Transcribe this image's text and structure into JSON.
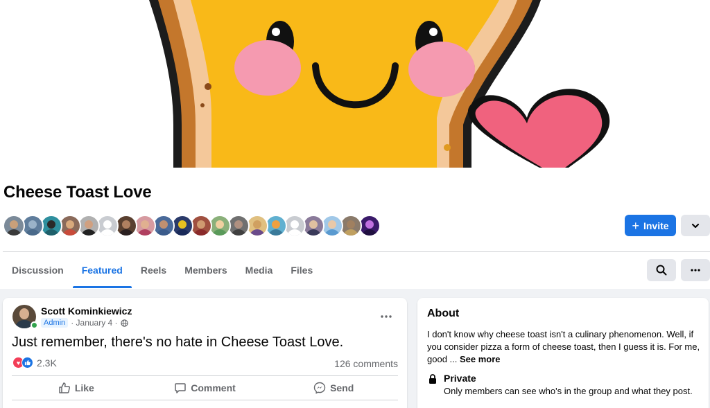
{
  "group": {
    "name": "Cheese Toast Love",
    "invite_label": "Invite"
  },
  "members_preview": [
    {
      "face": "#c9a07a",
      "body": "#3a3a3a",
      "bg": "#7b8a99"
    },
    {
      "face": "#9bb3c9",
      "body": "#4a6a8a",
      "bg": "#5f7d9c"
    },
    {
      "face": "#2a2a2a",
      "body": "#1e5f6a",
      "bg": "#2e8f9e"
    },
    {
      "face": "#d8a97c",
      "body": "#c84b3a",
      "bg": "#8a6a5a"
    },
    {
      "face": "#d0a080",
      "body": "#222222",
      "bg": "#b0b0b0"
    },
    {
      "face": "#ffffff",
      "body": "#ffffff",
      "bg": "#c9ccd1"
    },
    {
      "face": "#b08060",
      "body": "#2a2020",
      "bg": "#5a4030"
    },
    {
      "face": "#e0b090",
      "body": "#b04060",
      "bg": "#d69aa0"
    },
    {
      "face": "#c09070",
      "body": "#3b5b8b",
      "bg": "#4a6a9a"
    },
    {
      "face": "#e6c020",
      "body": "#1a2a5a",
      "bg": "#2a3a6a"
    },
    {
      "face": "#d09a70",
      "body": "#8a2a2a",
      "bg": "#a05040"
    },
    {
      "face": "#f0d0a0",
      "body": "#5a9a5a",
      "bg": "#8ab07a"
    },
    {
      "face": "#b09080",
      "body": "#404040",
      "bg": "#707070"
    },
    {
      "face": "#d0a060",
      "body": "#6a4a8a",
      "bg": "#e0c080"
    },
    {
      "face": "#f0a040",
      "body": "#3a7a9a",
      "bg": "#60b0d0"
    },
    {
      "face": "#ffffff",
      "body": "#ffffff",
      "bg": "#c9ccd1"
    },
    {
      "face": "#e0c0a0",
      "body": "#3a3a5a",
      "bg": "#8a7a9a"
    },
    {
      "face": "#e8c8a8",
      "body": "#5a9ad0",
      "bg": "#a0c8e8"
    },
    {
      "face": "#a08060",
      "body": "#c0a060",
      "bg": "#8a7a6a"
    },
    {
      "face": "#c070e0",
      "body": "#201040",
      "bg": "#3a1a6a"
    }
  ],
  "tabs": [
    {
      "label": "Discussion",
      "active": false
    },
    {
      "label": "Featured",
      "active": true
    },
    {
      "label": "Reels",
      "active": false
    },
    {
      "label": "Members",
      "active": false
    },
    {
      "label": "Media",
      "active": false
    },
    {
      "label": "Files",
      "active": false
    }
  ],
  "post": {
    "author": "Scott Kominkiewicz",
    "badge": "Admin",
    "date": "· January 4 ·",
    "text": "Just remember, there's no hate in Cheese Toast Love.",
    "reactions_count": "2.3K",
    "comments_count": "126 comments",
    "actions": {
      "like": "Like",
      "comment": "Comment",
      "send": "Send"
    }
  },
  "about": {
    "title": "About",
    "description": "I don't know why cheese toast isn't a culinary phenomenon. Well, if you consider pizza a form of cheese toast, then I guess it is. For me, good ...",
    "see_more": "See more",
    "privacy_title": "Private",
    "privacy_desc": "Only members can see who's in the group and what they post."
  },
  "colors": {
    "accent": "#1b74e4",
    "cheese": "#f9b918",
    "crust": "#c4772c",
    "blush": "#f59ab0",
    "heart": "#f0627e"
  }
}
